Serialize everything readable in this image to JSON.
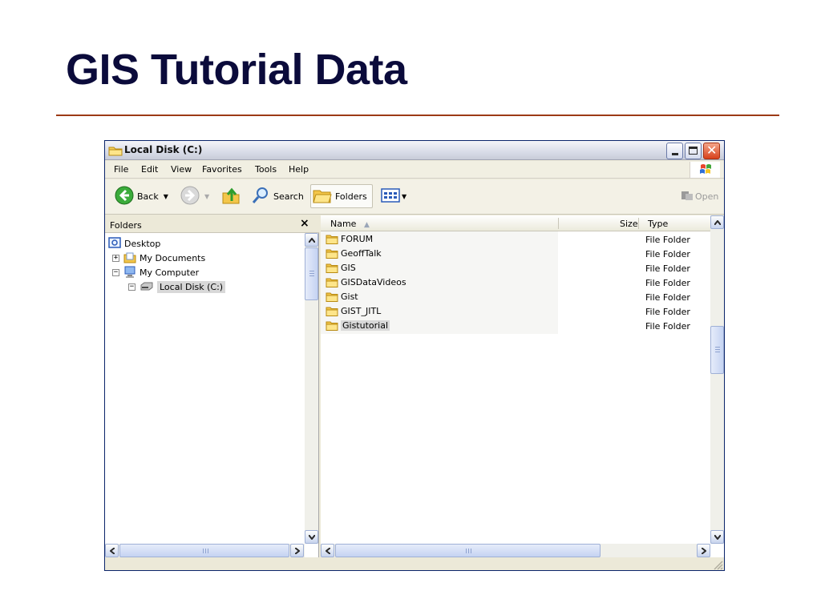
{
  "slide": {
    "title": "GIS Tutorial Data"
  },
  "window": {
    "title": "Local Disk (C:)",
    "menu": [
      "File",
      "Edit",
      "View",
      "Favorites",
      "Tools",
      "Help"
    ],
    "toolbar": {
      "back": "Back",
      "search": "Search",
      "folders": "Folders",
      "open": "Open"
    },
    "folders_pane": {
      "header": "Folders",
      "close_glyph": "×",
      "tree": [
        {
          "label": "Desktop",
          "icon": "desktop-icon"
        },
        {
          "label": "My Documents",
          "icon": "my-documents-icon",
          "expander": "+"
        },
        {
          "label": "My Computer",
          "icon": "my-computer-icon",
          "expander": "−"
        },
        {
          "label": "Local Disk (C:)",
          "icon": "local-disk-icon",
          "expander": "−"
        }
      ]
    },
    "file_list": {
      "columns": {
        "name": "Name",
        "size": "Size",
        "type": "Type"
      },
      "rows": [
        {
          "name": "FORUM",
          "type": "File Folder"
        },
        {
          "name": "GeoffTalk",
          "type": "File Folder"
        },
        {
          "name": "GIS",
          "type": "File Folder"
        },
        {
          "name": "GISDataVideos",
          "type": "File Folder"
        },
        {
          "name": "Gist",
          "type": "File Folder"
        },
        {
          "name": "GIST_JITL",
          "type": "File Folder"
        },
        {
          "name": "Gistutorial",
          "type": "File Folder"
        }
      ]
    }
  }
}
